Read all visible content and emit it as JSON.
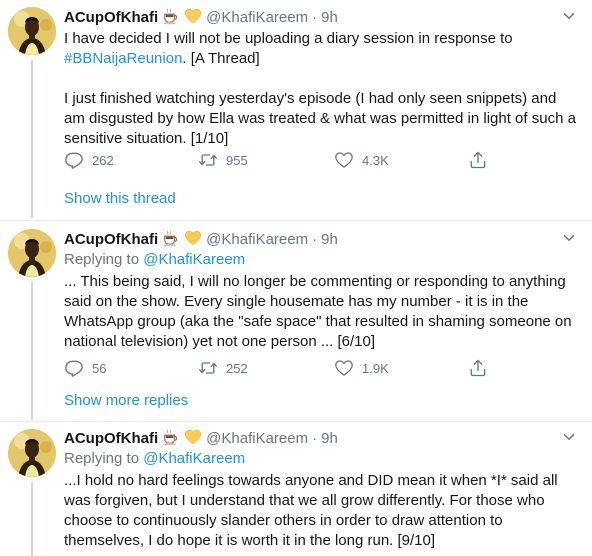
{
  "colors": {
    "link": "#1b95e0",
    "muted": "#657786",
    "text": "#14171a",
    "divider": "#e6ecf0"
  },
  "tweets": [
    {
      "name": "ACupOfKhafi",
      "emoji": [
        "tea-cup",
        "yellow-heart"
      ],
      "handle": "@KhafiKareem",
      "time": "9h",
      "replying_label": "",
      "replying_to": "",
      "text_p1_a": "I have decided I will not be uploading a diary session in response to ",
      "hashtag": "#BBNaijaReunion",
      "text_p1_b": ". [A Thread]",
      "text_p2": "I just finished watching yesterday's episode (I had only seen snippets) and am disgusted by how Ella was treated & what was permitted in light of such a sensitive situation. [1/10]",
      "replies": "262",
      "retweets": "955",
      "likes": "4.3K",
      "link": "Show this thread"
    },
    {
      "name": "ACupOfKhafi",
      "emoji": [
        "tea-cup",
        "yellow-heart"
      ],
      "handle": "@KhafiKareem",
      "time": "9h",
      "replying_label": "Replying to ",
      "replying_to": "@KhafiKareem",
      "text": "... This being said, I will no longer be commenting or responding to anything said on the show. Every single housemate has my number - it is in the WhatsApp group (aka the \"safe space\" that resulted in shaming someone on national television) yet not one person ... [6/10]",
      "replies": "56",
      "retweets": "252",
      "likes": "1.9K",
      "link": "Show more replies"
    },
    {
      "name": "ACupOfKhafi",
      "emoji": [
        "tea-cup",
        "yellow-heart"
      ],
      "handle": "@KhafiKareem",
      "time": "9h",
      "replying_label": "Replying to ",
      "replying_to": "@KhafiKareem",
      "text": "...I hold no hard feelings towards anyone and DID mean it when *I* said all was forgiven, but I understand that we all grow differently. For those who choose to continuously slander others in order to draw attention to themselves, I do hope it is worth it in the long run. [9/10]"
    }
  ]
}
